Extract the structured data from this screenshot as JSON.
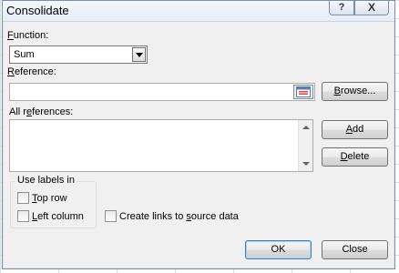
{
  "dialog": {
    "title": "Consolidate",
    "help_label": "?",
    "close_label": "X"
  },
  "function": {
    "label_mnemonic": "F",
    "label_rest": "unction:",
    "value": "Sum"
  },
  "reference": {
    "label_mnemonic": "R",
    "label_rest": "eference:",
    "value": "",
    "browse_pre": "",
    "browse_mnemonic": "B",
    "browse_post": "rowse..."
  },
  "all_references": {
    "label_pre": "All r",
    "label_mnemonic": "e",
    "label_post": "ferences:",
    "add_mnemonic": "A",
    "add_post": "dd",
    "delete_mnemonic": "D",
    "delete_post": "elete"
  },
  "use_labels": {
    "title": "Use labels in",
    "top_row_mnemonic": "T",
    "top_row_post": "op row",
    "top_row_checked": false,
    "left_column_mnemonic": "L",
    "left_column_post": "eft column",
    "left_column_checked": false
  },
  "create_links": {
    "pre": "Create links to ",
    "mnemonic": "s",
    "post": "ource data",
    "checked": false
  },
  "buttons": {
    "ok": "OK",
    "close": "Close"
  },
  "icons": {
    "collapse": "collapse-dialog-icon",
    "dropdown": "chevron-down-icon"
  }
}
